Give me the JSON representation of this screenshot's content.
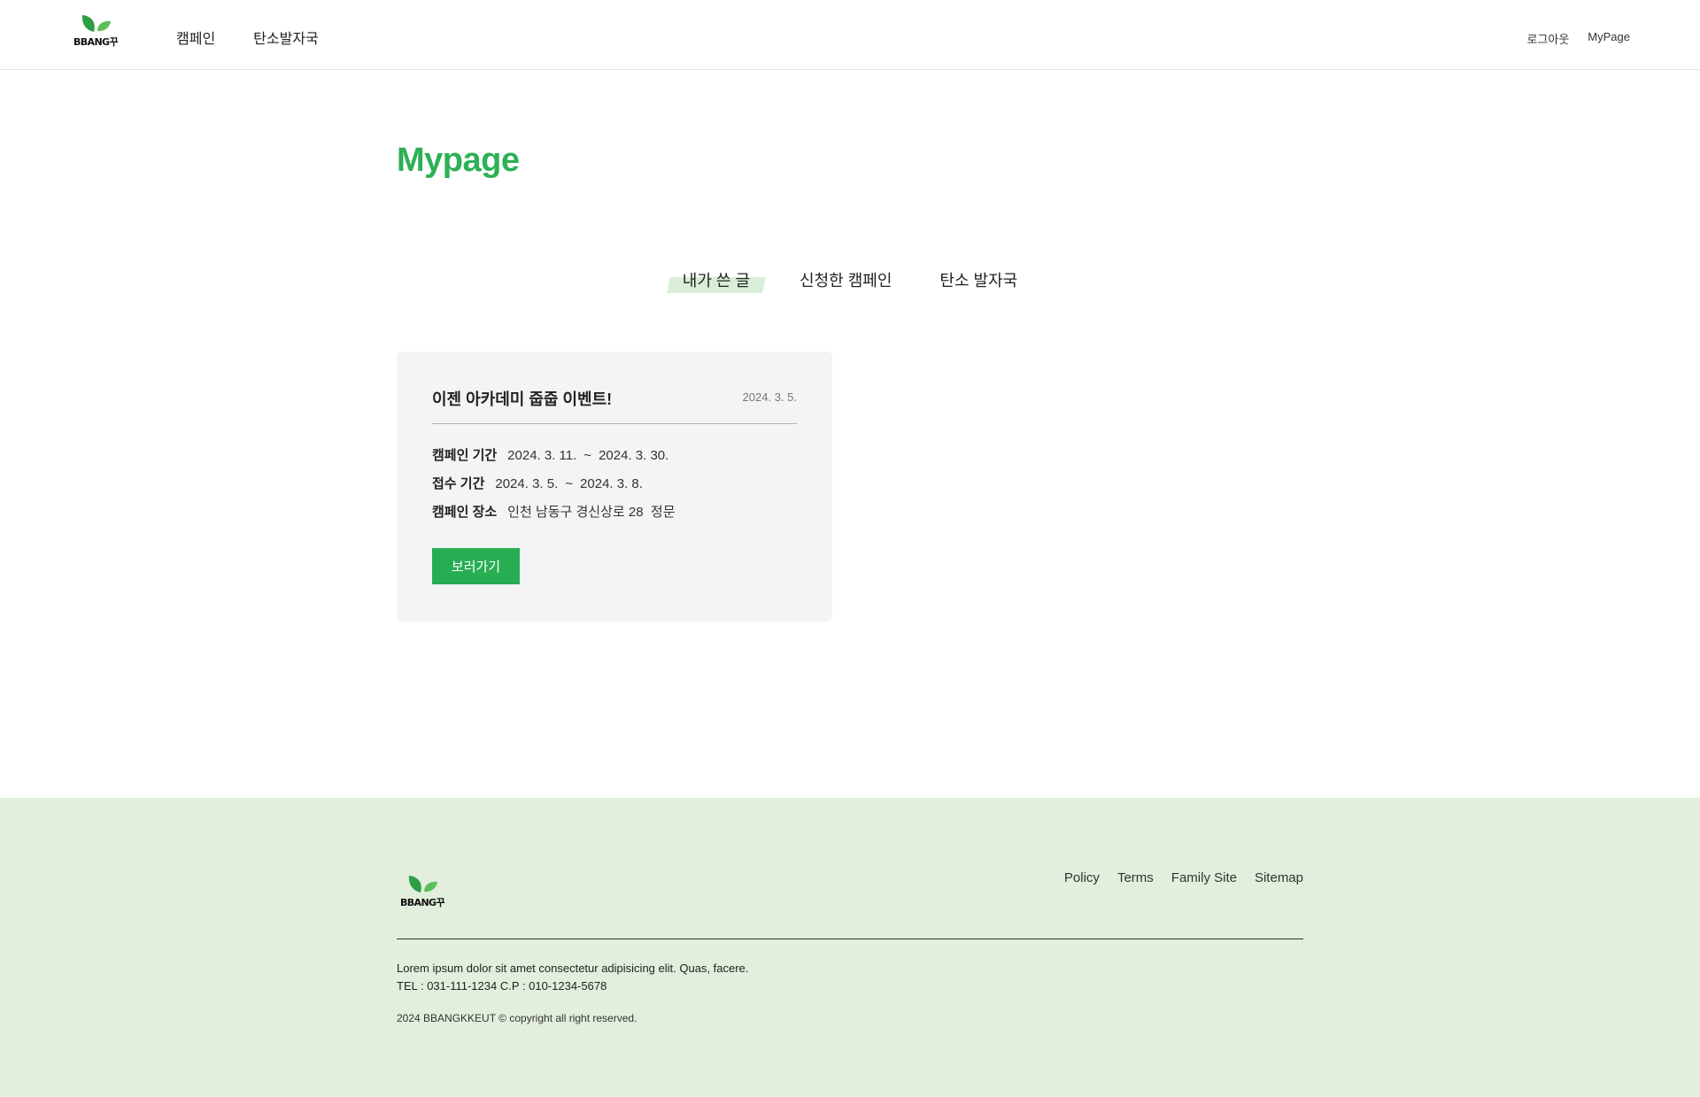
{
  "header": {
    "logo_text": "BBANG꾸",
    "nav": [
      "캠페인",
      "탄소발자국"
    ],
    "util": [
      "로그아웃",
      "MyPage"
    ]
  },
  "page": {
    "title": "Mypage"
  },
  "tabs": [
    "내가 쓴 글",
    "신청한 캠페인",
    "탄소 발자국"
  ],
  "active_tab": "내가 쓴 글",
  "post": {
    "title": "이젠 아카데미 줍줍 이벤트!",
    "date": "2024. 3. 5.",
    "campaign_period_label": "캠페인 기간",
    "campaign_start": "2024. 3. 11.",
    "campaign_end": "2024. 3. 30.",
    "apply_period_label": "접수 기간",
    "apply_start": "2024. 3. 5.",
    "apply_end": "2024. 3. 8.",
    "tilde": "~",
    "place_label": "캠페인 장소",
    "place": "인천 남동구 경신상로 28  정문",
    "button": "보러가기"
  },
  "footer": {
    "logo_text": "BBANG꾸",
    "links": [
      "Policy",
      "Terms",
      "Family Site",
      "Sitemap"
    ],
    "desc": "Lorem ipsum dolor sit amet consectetur adipisicing elit. Quas, facere.",
    "tel": "TEL : 031-111-1234 C.P : 010-1234-5678",
    "copyright": "2024 BBANGKKEUT © copyright all right reserved."
  },
  "colors": {
    "brand": "#2db055",
    "button": "#27ae53",
    "tab_highlight": "#d8eed6",
    "footer_bg": "#e1efdc",
    "card_bg": "#f4f4f4"
  },
  "icons": {
    "logo": "leaf-icon"
  }
}
